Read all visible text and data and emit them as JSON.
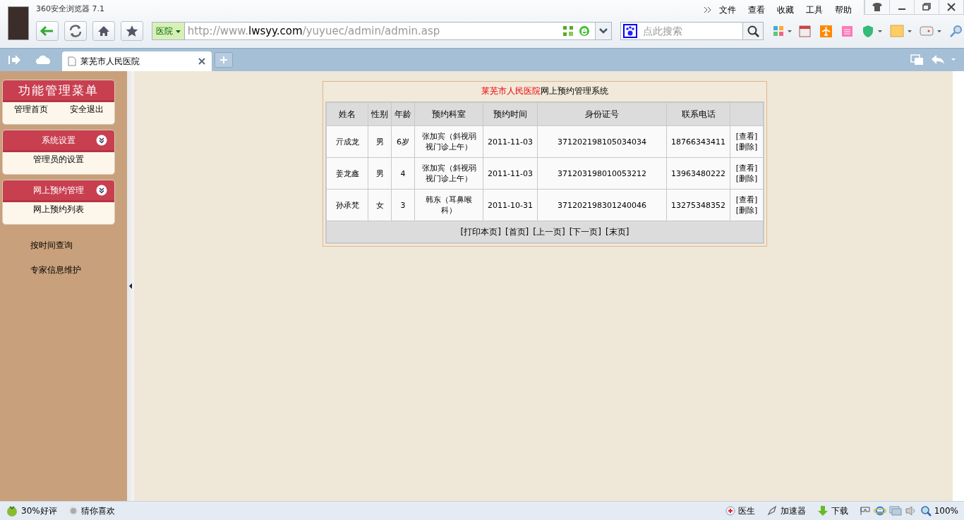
{
  "browser": {
    "title": "360安全浏览器 7.1",
    "menu": [
      "文件",
      "查看",
      "收藏",
      "工具",
      "帮助"
    ],
    "address": {
      "scope": "医院",
      "url_prefix": "http://www.",
      "url_domain": "lwsyy.com",
      "url_path": "/yuyuec/admin/admin.asp"
    },
    "search": {
      "placeholder": "点此搜索"
    }
  },
  "tabs": [
    {
      "label": "莱芜市人民医院",
      "selected": true
    }
  ],
  "sidebar": {
    "panels": [
      {
        "kind": "main",
        "title": "功能管理菜单",
        "items": [
          "管理首页",
          "安全退出"
        ]
      },
      {
        "kind": "section",
        "title": "系统设置",
        "items": [
          "管理员的设置"
        ]
      },
      {
        "kind": "section",
        "title": "网上预约管理",
        "items": [
          "网上预约列表"
        ]
      }
    ],
    "links": [
      "按时间查询",
      "专家信息维护"
    ]
  },
  "table": {
    "title_highlight": "莱芜市人民医院",
    "title_rest": "网上预约管理系统",
    "columns": [
      "姓名",
      "性别",
      "年龄",
      "预约科室",
      "预约时间",
      "身份证号",
      "联系电话"
    ],
    "rows": [
      {
        "cells": [
          "亓成龙",
          "男",
          "6岁",
          "张加宾（斜视弱视门诊上午）",
          "2011-11-03",
          "371202198105034034",
          "18766343411"
        ],
        "actions": [
          "[查看]",
          "[删除]"
        ]
      },
      {
        "cells": [
          "姜龙鑫",
          "男",
          "4",
          "张加宾（斜视弱视门诊上午）",
          "2011-11-03",
          "371203198010053212",
          "13963480222"
        ],
        "actions": [
          "[查看]",
          "[删除]"
        ]
      },
      {
        "cells": [
          "孙承梵",
          "女",
          "3",
          "韩东（耳鼻喉科）",
          "2011-10-31",
          "371202198301240046",
          "13275348352"
        ],
        "actions": [
          "[查看]",
          "[删除]"
        ]
      }
    ],
    "pager": [
      "[打印本页]",
      "[首页]",
      "[上一页]",
      "[下一页]",
      "[末页]"
    ]
  },
  "status_bar": {
    "left": [
      "30%好评",
      "猜你喜欢"
    ],
    "right": [
      "医生",
      "加速器",
      "下载"
    ],
    "zoom": "100%"
  }
}
